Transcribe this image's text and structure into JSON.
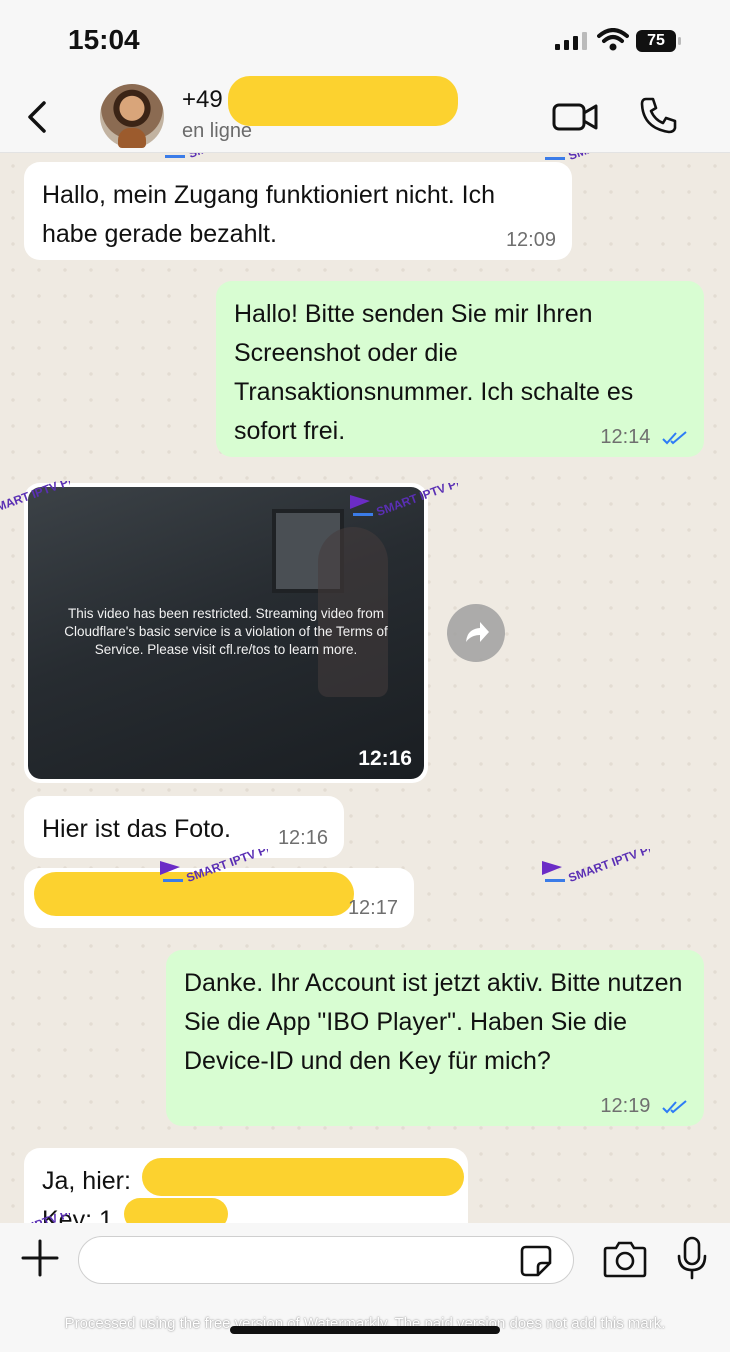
{
  "status_bar": {
    "time": "15:04",
    "battery": "75"
  },
  "header": {
    "contact_name": "+49",
    "contact_status": "en ligne"
  },
  "watermark": {
    "brand": "SMART IPTV PRO"
  },
  "messages": [
    {
      "type": "in",
      "text": "Hallo, mein Zugang funktioniert nicht. Ich habe gerade bezahlt.",
      "time": "12:09"
    },
    {
      "type": "out",
      "text": "Hallo! Bitte senden Sie mir Ihren Screenshot oder die Transaktionsnummer. Ich schalte es sofort frei.",
      "time": "12:14",
      "read": true
    },
    {
      "type": "image",
      "overlay_text": "This video has been restricted. Streaming video from Cloudflare's basic service is a violation of the Terms of Service. Please visit cfl.re/tos to learn more.",
      "time": "12:16"
    },
    {
      "type": "in",
      "text": "Hier ist das Foto.",
      "time": "12:16"
    },
    {
      "type": "in",
      "text": "",
      "time": "12:17",
      "redacted": true
    },
    {
      "type": "out",
      "text": "Danke. Ihr Account ist jetzt aktiv. Bitte nutzen Sie die App \"IBO Player\". Haben Sie die Device-ID und den Key für mich?",
      "time": "12:19",
      "read": true
    },
    {
      "type": "in",
      "line1": "Ja, hier:",
      "line2": "Key: 1",
      "redacted": true
    }
  ],
  "input": {
    "placeholder": ""
  },
  "footer_note": "Processed using the free version of Watermarkly. The paid version does not add this mark.",
  "colors": {
    "incoming": "#ffffff",
    "outgoing": "#d8fdd2",
    "background": "#efeae2",
    "read_ticks": "#2e7cf6",
    "redaction": "#fcd22f"
  }
}
